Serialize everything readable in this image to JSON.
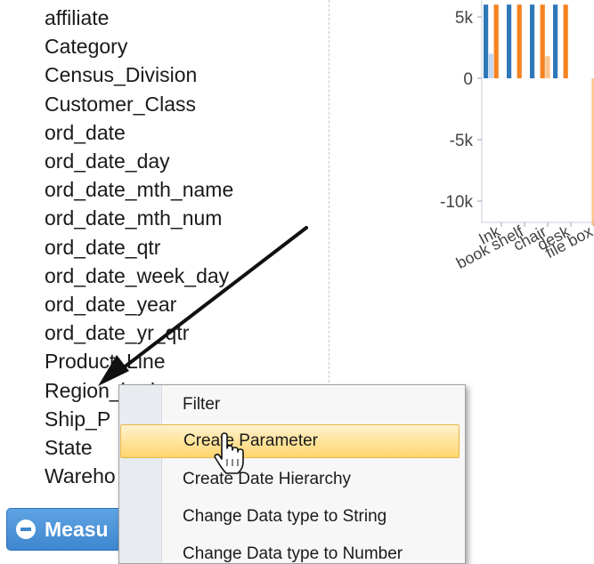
{
  "fields": [
    "affiliate",
    "Category",
    "Census_Division",
    "Customer_Class",
    "ord_date",
    "ord_date_day",
    "ord_date_mth_name",
    "ord_date_mth_num",
    "ord_date_qtr",
    "ord_date_week_day",
    "ord_date_year",
    "ord_date_yr_qtr",
    "Product_Line",
    "Region_had",
    "Ship_P",
    "State",
    "Wareho"
  ],
  "measures_label": "Measu",
  "context_menu": {
    "items": [
      "Filter",
      "Create Parameter",
      "Create Date Hierarchy",
      "Change Data type to String",
      "Change Data type to Number"
    ],
    "hovered_index": 1
  },
  "chart_data": {
    "type": "bar",
    "yticks": [
      5000,
      0,
      -5000,
      -10000
    ],
    "ytick_labels": [
      "5k",
      "0",
      "-5k",
      "-10k"
    ],
    "ylim": [
      -12000,
      6000
    ],
    "categories": [
      "Ink",
      "book shelf",
      "chair",
      "desk",
      "file box"
    ],
    "series": [
      {
        "color": "#2f78b8",
        "values": [
          6000,
          6000,
          6000,
          6000,
          0
        ]
      },
      {
        "color": "#c4d7ee",
        "values": [
          2000,
          0,
          0,
          0,
          0
        ]
      },
      {
        "color": "#f58220",
        "values": [
          6000,
          6000,
          6000,
          6000,
          0
        ]
      },
      {
        "color": "#fcc58f",
        "values": [
          0,
          0,
          1800,
          0,
          -12000
        ]
      }
    ]
  },
  "colors": {
    "measures_bar": "#3e86cf",
    "menu_hover": "#ffd66e",
    "arrow": "#111111"
  }
}
